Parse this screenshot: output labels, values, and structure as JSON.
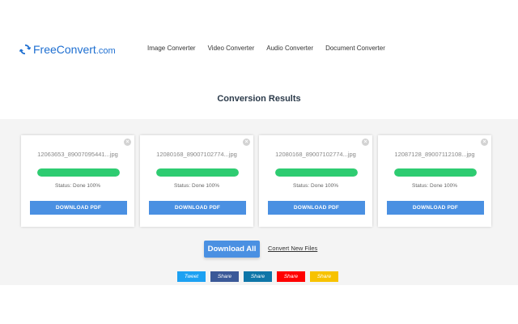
{
  "header": {
    "logo_main": "FreeConvert",
    "logo_tld": ".com",
    "nav": [
      {
        "label": "Image Converter"
      },
      {
        "label": "Video Converter"
      },
      {
        "label": "Audio Converter"
      },
      {
        "label": "Document Converter"
      }
    ]
  },
  "page_title": "Conversion Results",
  "results": {
    "files": [
      {
        "filename": "12063653_89007095441...jpg",
        "progress": 100,
        "status": "Status: Done 100%",
        "download_label": "DOWNLOAD PDF"
      },
      {
        "filename": "12080168_89007102774...jpg",
        "progress": 100,
        "status": "Status: Done 100%",
        "download_label": "DOWNLOAD PDF"
      },
      {
        "filename": "12080168_89007102774...jpg",
        "progress": 100,
        "status": "Status: Done 100%",
        "download_label": "DOWNLOAD PDF"
      },
      {
        "filename": "12087128_89007112108...jpg",
        "progress": 100,
        "status": "Status: Done 100%",
        "download_label": "DOWNLOAD PDF"
      }
    ],
    "download_all_label": "Download All",
    "convert_new_label": "Convert New Files"
  },
  "share": [
    {
      "label": "Tweet",
      "color": "#1da1f2"
    },
    {
      "label": "Share",
      "color": "#3b5998"
    },
    {
      "label": "Share",
      "color": "#0e76a8"
    },
    {
      "label": "Share",
      "color": "#ff0000"
    },
    {
      "label": "Share",
      "color": "#f7c200"
    }
  ],
  "colors": {
    "brand": "#1e6fd1",
    "primary_button": "#4a90e2",
    "progress": "#2ecc71"
  }
}
